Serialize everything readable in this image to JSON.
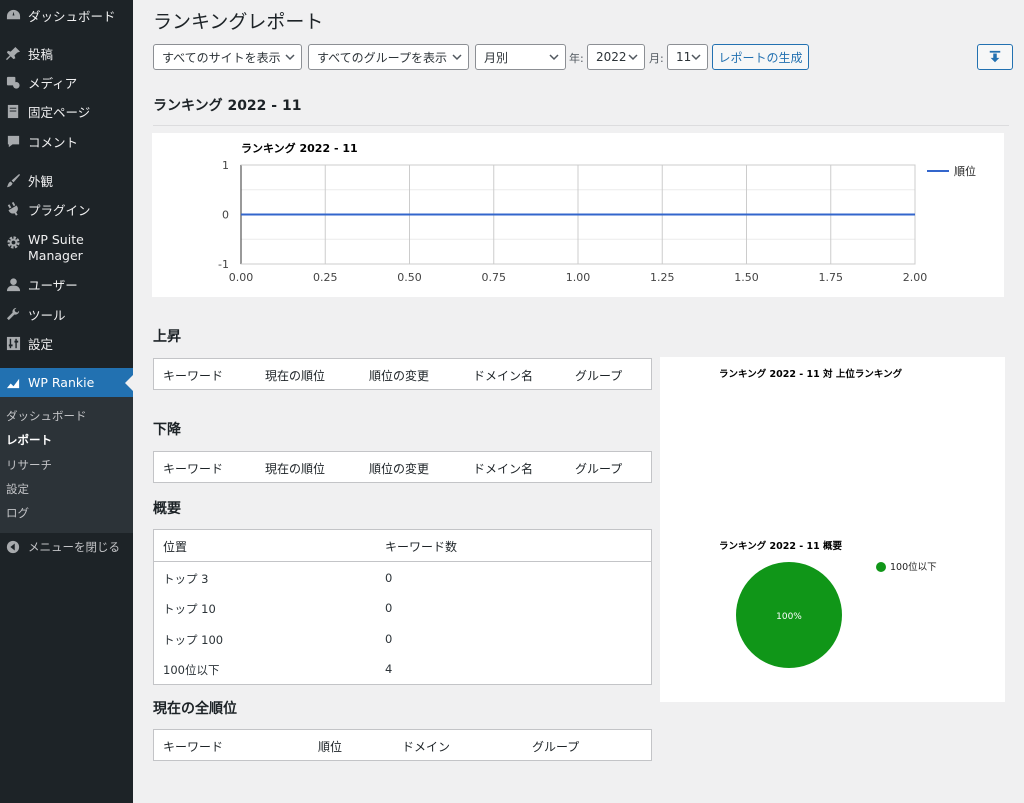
{
  "sidebar": {
    "items": [
      {
        "label": "ダッシュボード",
        "icon": "dashboard-icon"
      },
      {
        "label": "投稿",
        "icon": "pin-icon"
      },
      {
        "label": "メディア",
        "icon": "media-icon"
      },
      {
        "label": "固定ページ",
        "icon": "page-icon"
      },
      {
        "label": "コメント",
        "icon": "comment-icon"
      },
      {
        "label": "外観",
        "icon": "brush-icon"
      },
      {
        "label": "プラグイン",
        "icon": "plug-icon"
      },
      {
        "label": "WP Suite Manager",
        "icon": "gear-icon"
      },
      {
        "label": "ユーザー",
        "icon": "user-icon"
      },
      {
        "label": "ツール",
        "icon": "wrench-icon"
      },
      {
        "label": "設定",
        "icon": "settings-icon"
      },
      {
        "label": "WP Rankie",
        "icon": "chart-icon"
      }
    ],
    "wp_suite_line1": "WP Suite",
    "wp_suite_line2": "Manager",
    "submenu": [
      "ダッシュボード",
      "レポート",
      "リサーチ",
      "設定",
      "ログ"
    ],
    "collapse": "メニューを閉じる",
    "active_color": "#2271b1"
  },
  "page": {
    "title": "ランキングレポート",
    "filters": {
      "sites": "すべてのサイトを表示",
      "groups": "すべてのグループを表示",
      "period": "月別",
      "year_label": "年:",
      "year": "2022",
      "month_label": "月:",
      "month": "11",
      "generate": "レポートの生成"
    },
    "section_title": "ランキング 2022 - 11"
  },
  "line_chart": {
    "title": "ランキング 2022 - 11",
    "legend": "順位",
    "color": "#3366cc"
  },
  "chart_data": [
    {
      "type": "line",
      "title": "ランキング 2022 - 11",
      "series": [
        {
          "name": "順位",
          "x": [
            0,
            2
          ],
          "y": [
            0,
            0
          ]
        }
      ],
      "xlim": [
        0,
        2
      ],
      "ylim": [
        -1,
        1
      ],
      "xticks": [
        "0.00",
        "0.25",
        "0.50",
        "0.75",
        "1.00",
        "1.25",
        "1.50",
        "1.75",
        "2.00"
      ],
      "yticks": [
        "1",
        "0",
        "-1"
      ],
      "grid": true,
      "legend": "right"
    },
    {
      "type": "pie",
      "title": "ランキング 2022 - 11 概要",
      "labels": [
        "100位以下"
      ],
      "values": [
        100
      ],
      "colors": [
        "#109618"
      ],
      "legend": "right"
    }
  ],
  "rise": {
    "title": "上昇",
    "headers": [
      "キーワード",
      "現在の順位",
      "順位の変更",
      "ドメイン名",
      "グループ"
    ]
  },
  "fall": {
    "title": "下降",
    "headers": [
      "キーワード",
      "現在の順位",
      "順位の変更",
      "ドメイン名",
      "グループ"
    ]
  },
  "summary": {
    "title": "概要",
    "headers": [
      "位置",
      "キーワード数"
    ],
    "rows": [
      {
        "position": "トップ 3",
        "count": "0"
      },
      {
        "position": "トップ 10",
        "count": "0"
      },
      {
        "position": "トップ 100",
        "count": "0"
      },
      {
        "position": "100位以下",
        "count": "4"
      }
    ]
  },
  "current": {
    "title": "現在の全順位",
    "headers": [
      "キーワード",
      "順位",
      "ドメイン",
      "グループ"
    ]
  },
  "side_chart": {
    "top_title": "ランキング 2022 - 11 対 上位ランキング",
    "pie_title": "ランキング 2022 - 11 概要",
    "pie_label": "100%",
    "pie_legend": "100位以下",
    "pie_color": "#109618"
  }
}
